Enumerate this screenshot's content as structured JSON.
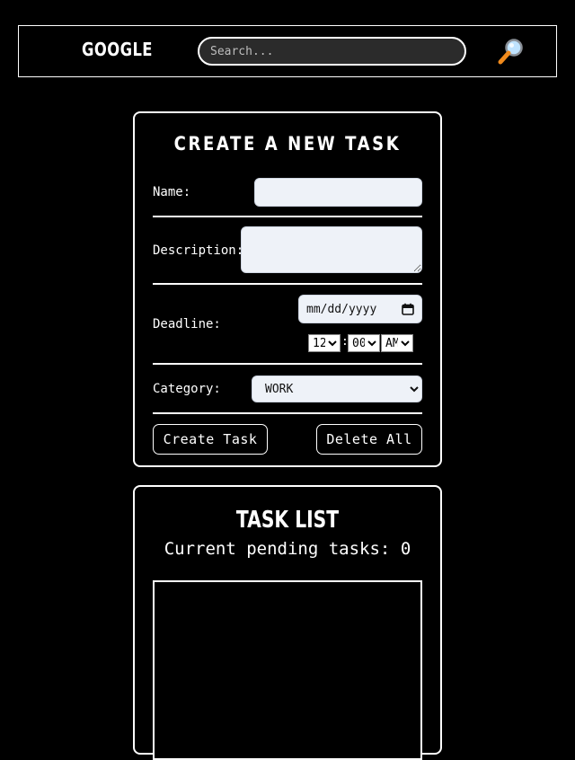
{
  "header": {
    "brand": "GOOGLE",
    "search_placeholder": "Search..."
  },
  "create_form": {
    "title": "CREATE A NEW TASK",
    "name_label": "Name:",
    "description_label": "Description:",
    "deadline_label": "Deadline:",
    "date_placeholder": "mm/dd/yyyy",
    "hour_value": "12",
    "time_separator": ":",
    "minute_value": "00",
    "ampm_value": "AM",
    "category_label": "Category:",
    "category_value": "WORK",
    "create_button": "Create Task",
    "delete_button": "Delete All"
  },
  "task_list": {
    "title": "TASK LIST",
    "pending_text": "Current pending tasks: 0"
  },
  "icons": {
    "search": "magnifier-icon",
    "calendar": "calendar-icon"
  }
}
